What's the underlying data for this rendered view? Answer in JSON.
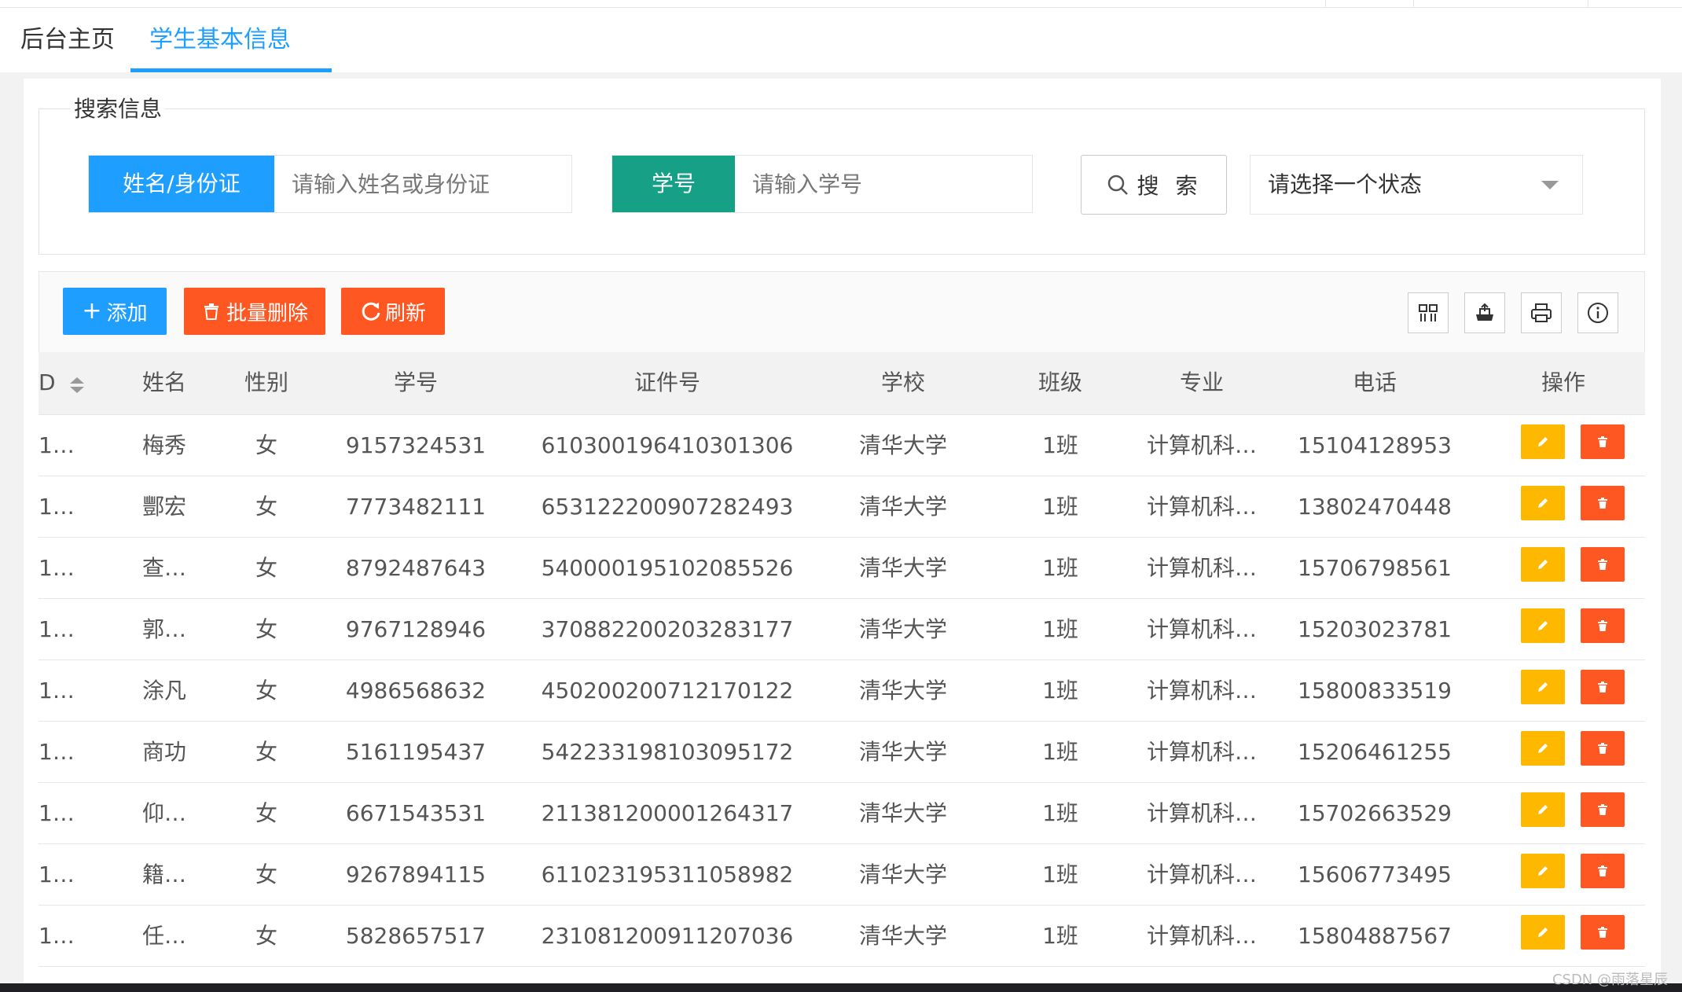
{
  "tabs": {
    "home": "后台主页",
    "active": "学生基本信息",
    "close_glyph": "✕"
  },
  "search": {
    "legend": "搜索信息",
    "name_label": "姓名/身份证",
    "name_placeholder": "请输入姓名或身份证",
    "name_label_color": "#1e9fff",
    "sno_label": "学号",
    "sno_placeholder": "请输入学号",
    "sno_label_color": "#16a086",
    "search_button": "搜 索",
    "status_select": "请选择一个状态"
  },
  "toolbar": {
    "add": "添加",
    "batch_delete": "批量删除",
    "refresh": "刷新",
    "add_color": "#1e9fff",
    "danger_color": "#ff5722",
    "icons": [
      "columns-icon",
      "export-icon",
      "print-icon",
      "info-icon"
    ]
  },
  "table": {
    "columns": [
      "D",
      "姓名",
      "性别",
      "学号",
      "证件号",
      "学校",
      "班级",
      "专业",
      "电话",
      "操作"
    ],
    "rows": [
      {
        "id": "1…",
        "name": "梅秀",
        "gender": "女",
        "sno": "9157324531",
        "idcard": "610300196410301306",
        "school": "清华大学",
        "class": "1班",
        "major": "计算机科…",
        "phone": "15104128953"
      },
      {
        "id": "1…",
        "name": "酆宏",
        "gender": "女",
        "sno": "7773482111",
        "idcard": "653122200907282493",
        "school": "清华大学",
        "class": "1班",
        "major": "计算机科…",
        "phone": "13802470448"
      },
      {
        "id": "1…",
        "name": "查…",
        "gender": "女",
        "sno": "8792487643",
        "idcard": "540000195102085526",
        "school": "清华大学",
        "class": "1班",
        "major": "计算机科…",
        "phone": "15706798561"
      },
      {
        "id": "1…",
        "name": "郭…",
        "gender": "女",
        "sno": "9767128946",
        "idcard": "370882200203283177",
        "school": "清华大学",
        "class": "1班",
        "major": "计算机科…",
        "phone": "15203023781"
      },
      {
        "id": "1…",
        "name": "涂凡",
        "gender": "女",
        "sno": "4986568632",
        "idcard": "450200200712170122",
        "school": "清华大学",
        "class": "1班",
        "major": "计算机科…",
        "phone": "15800833519"
      },
      {
        "id": "1…",
        "name": "商功",
        "gender": "女",
        "sno": "5161195437",
        "idcard": "542233198103095172",
        "school": "清华大学",
        "class": "1班",
        "major": "计算机科…",
        "phone": "15206461255"
      },
      {
        "id": "1…",
        "name": "仰…",
        "gender": "女",
        "sno": "6671543531",
        "idcard": "211381200001264317",
        "school": "清华大学",
        "class": "1班",
        "major": "计算机科…",
        "phone": "15702663529"
      },
      {
        "id": "1…",
        "name": "籍…",
        "gender": "女",
        "sno": "9267894115",
        "idcard": "611023195311058982",
        "school": "清华大学",
        "class": "1班",
        "major": "计算机科…",
        "phone": "15606773495"
      },
      {
        "id": "1…",
        "name": "任…",
        "gender": "女",
        "sno": "5828657517",
        "idcard": "231081200911207036",
        "school": "清华大学",
        "class": "1班",
        "major": "计算机科…",
        "phone": "15804887567"
      }
    ],
    "edit_color": "#ffb800",
    "delete_color": "#ff5722"
  },
  "watermark": "CSDN @雨落星辰"
}
